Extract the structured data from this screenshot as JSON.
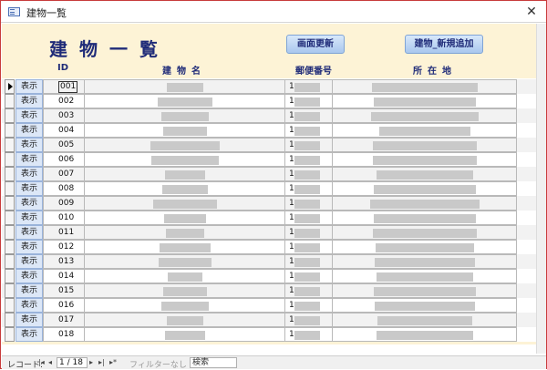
{
  "window": {
    "title": "建物一覧",
    "close_glyph": "✕"
  },
  "header": {
    "title": "建物一覧",
    "refresh_label": "画面更新",
    "add_label": "建物_新規追加",
    "columns": {
      "id": "ID",
      "name": "建物名",
      "zip": "郵便番号",
      "address": "所在地"
    }
  },
  "rows": [
    {
      "show": "表示",
      "id": "001",
      "zip_prefix": "1"
    },
    {
      "show": "表示",
      "id": "002",
      "zip_prefix": "1"
    },
    {
      "show": "表示",
      "id": "003",
      "zip_prefix": "1"
    },
    {
      "show": "表示",
      "id": "004",
      "zip_prefix": "1"
    },
    {
      "show": "表示",
      "id": "005",
      "zip_prefix": "1"
    },
    {
      "show": "表示",
      "id": "006",
      "zip_prefix": "1"
    },
    {
      "show": "表示",
      "id": "007",
      "zip_prefix": "1"
    },
    {
      "show": "表示",
      "id": "008",
      "zip_prefix": "1"
    },
    {
      "show": "表示",
      "id": "009",
      "zip_prefix": "1"
    },
    {
      "show": "表示",
      "id": "010",
      "zip_prefix": "1"
    },
    {
      "show": "表示",
      "id": "011",
      "zip_prefix": "1"
    },
    {
      "show": "表示",
      "id": "012",
      "zip_prefix": "1"
    },
    {
      "show": "表示",
      "id": "013",
      "zip_prefix": "1"
    },
    {
      "show": "表示",
      "id": "014",
      "zip_prefix": "1"
    },
    {
      "show": "表示",
      "id": "015",
      "zip_prefix": "1"
    },
    {
      "show": "表示",
      "id": "016",
      "zip_prefix": "1"
    },
    {
      "show": "表示",
      "id": "017",
      "zip_prefix": "1"
    },
    {
      "show": "表示",
      "id": "018",
      "zip_prefix": "1"
    }
  ],
  "navigation": {
    "record_label": "レコード:",
    "position": "1 / 18",
    "filter_label": "フィルターなし",
    "search_label": "検索",
    "first": "|◂",
    "prev": "◂",
    "next": "▸",
    "last": "▸|",
    "new": "▸*"
  }
}
